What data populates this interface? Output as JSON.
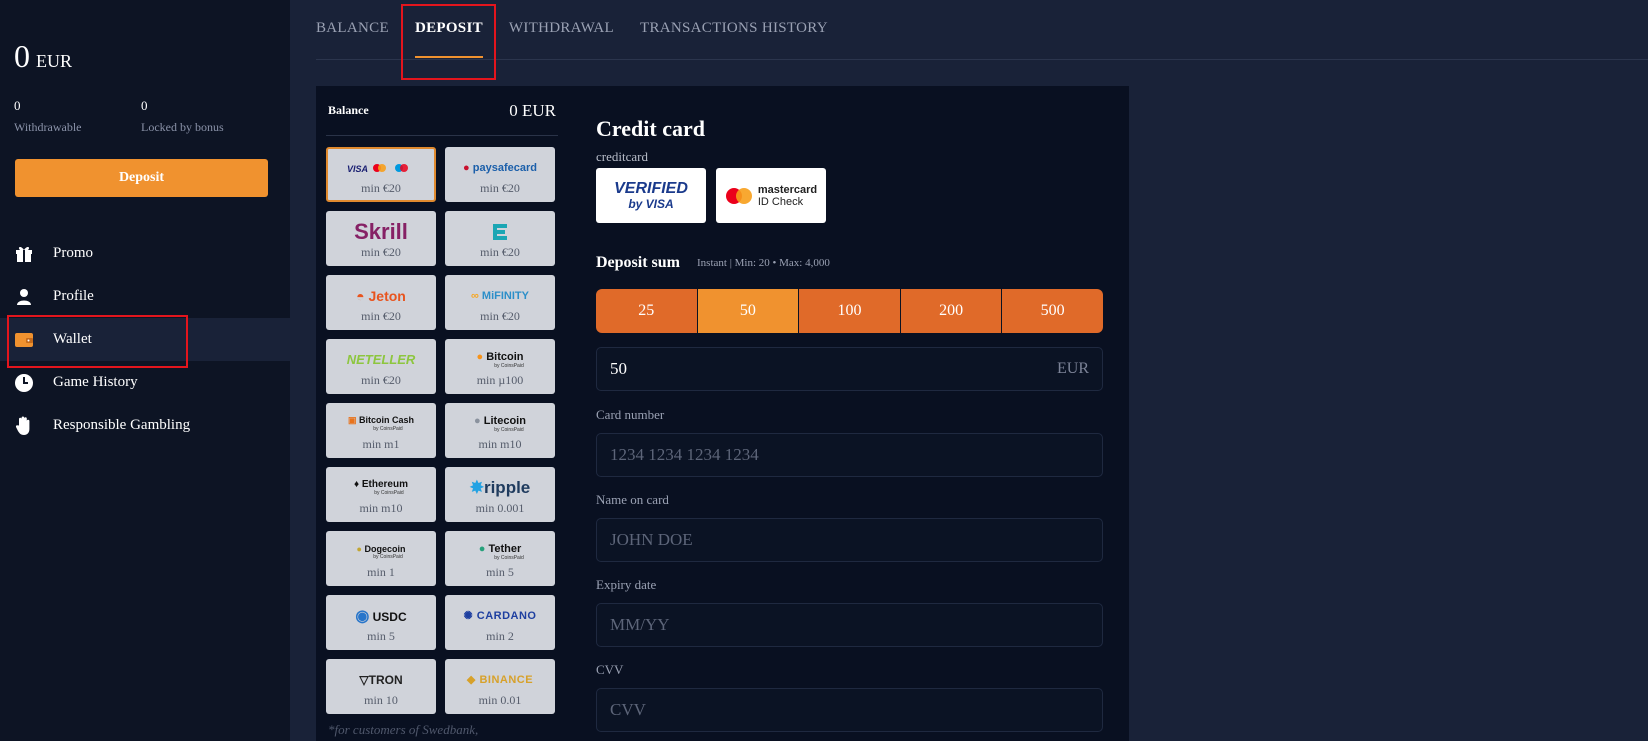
{
  "sidebar": {
    "balance_value": "0",
    "balance_currency": "EUR",
    "withdrawable_value": "0",
    "withdrawable_label": "Withdrawable",
    "locked_value": "0",
    "locked_label": "Locked by bonus",
    "deposit_label": "Deposit",
    "nav": [
      {
        "label": "Promo",
        "icon": "gift-icon"
      },
      {
        "label": "Profile",
        "icon": "user-icon"
      },
      {
        "label": "Wallet",
        "icon": "wallet-icon"
      },
      {
        "label": "Game History",
        "icon": "clock-icon"
      },
      {
        "label": "Responsible Gambling",
        "icon": "hand-icon"
      }
    ]
  },
  "tabs": [
    {
      "label": "BALANCE"
    },
    {
      "label": "DEPOSIT"
    },
    {
      "label": "WITHDRAWAL"
    },
    {
      "label": "TRANSACTIONS HISTORY"
    }
  ],
  "panel": {
    "balance_label": "Balance",
    "balance_amount": "0 EUR",
    "methods": [
      {
        "name": "VISA / Mastercard / Maestro",
        "min": "min €20"
      },
      {
        "name": "paysafecard",
        "min": "min €20"
      },
      {
        "name": "Skrill",
        "min": "min €20"
      },
      {
        "name": "Ezeewallet",
        "min": "min €20"
      },
      {
        "name": "Jeton",
        "min": "min €20"
      },
      {
        "name": "MiFINITY",
        "min": "min €20"
      },
      {
        "name": "NETELLER",
        "min": "min €20"
      },
      {
        "name": "Bitcoin",
        "min": "min µ100"
      },
      {
        "name": "Bitcoin Cash",
        "min": "min m1"
      },
      {
        "name": "Litecoin",
        "min": "min m10"
      },
      {
        "name": "Ethereum",
        "min": "min m10"
      },
      {
        "name": "ripple",
        "min": "min 0.001"
      },
      {
        "name": "Dogecoin",
        "min": "min 1"
      },
      {
        "name": "Tether",
        "min": "min 5"
      },
      {
        "name": "USDC",
        "min": "min 5"
      },
      {
        "name": "CARDANO",
        "min": "min 2"
      },
      {
        "name": "TRON",
        "min": "min 10"
      },
      {
        "name": "BINANCE",
        "min": "min 0.01"
      }
    ],
    "coinspaid_label": "by CoinsPaid",
    "footnote": "*for customers of Swedbank,"
  },
  "credit_card": {
    "title": "Credit card",
    "subtitle": "creditcard",
    "badge_visa_line1": "VERIFIED",
    "badge_visa_line2": "by VISA",
    "badge_mc_line1": "mastercard",
    "badge_mc_line2": "ID Check",
    "deposit_sum_label": "Deposit sum",
    "deposit_info": "Instant | Min: 20 • Max: 4,000",
    "amounts": [
      "25",
      "50",
      "100",
      "200",
      "500"
    ],
    "selected_amount": "50",
    "amount_value": "50",
    "currency": "EUR",
    "card_number_label": "Card number",
    "card_number_placeholder": "1234 1234 1234 1234",
    "name_label": "Name on card",
    "name_placeholder": "JOHN DOE",
    "expiry_label": "Expiry date",
    "expiry_placeholder": "MM/YY",
    "cvv_label": "CVV",
    "cvv_placeholder": "CVV"
  },
  "colors": {
    "accent": "#f0922f",
    "amount_button": "#e06a29",
    "highlight": "#e3151d"
  }
}
